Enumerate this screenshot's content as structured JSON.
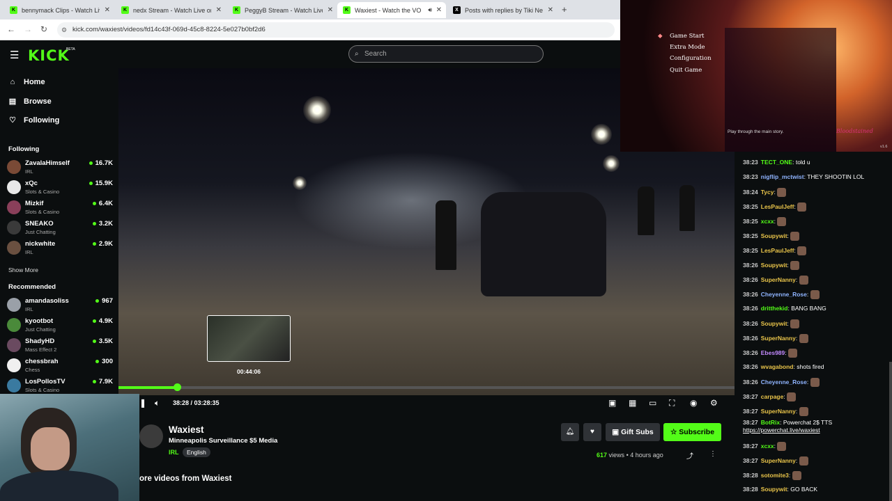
{
  "browser": {
    "tabs": [
      {
        "title": "bennymack Clips - Watch Live o",
        "icon": "kick-favicon"
      },
      {
        "title": "nedx Stream - Watch Live on Ki",
        "icon": "kick-favicon"
      },
      {
        "title": "PeggyB Stream - Watch Live on",
        "icon": "kick-favicon"
      },
      {
        "title": "Waxiest - Watch the VOD o",
        "icon": "kick-favicon",
        "active": true
      },
      {
        "title": "Posts with replies by Tiki NedX",
        "icon": "x-favicon"
      }
    ],
    "url": "kick.com/waxiest/videos/fd14c43f-069d-45c8-8224-5e027b0bf2d6"
  },
  "header": {
    "logo": "KICK",
    "beta": "BETA",
    "search_placeholder": "Search"
  },
  "sidebar": {
    "nav": [
      {
        "label": "Home",
        "icon": "home-icon"
      },
      {
        "label": "Browse",
        "icon": "browse-icon"
      },
      {
        "label": "Following",
        "icon": "heart-icon"
      }
    ],
    "following_title": "Following",
    "following": [
      {
        "name": "ZavalaHimself",
        "category": "IRL",
        "viewers": "16.7K"
      },
      {
        "name": "xQc",
        "category": "Slots & Casino",
        "viewers": "15.9K"
      },
      {
        "name": "Mizkif",
        "category": "Slots & Casino",
        "viewers": "6.4K"
      },
      {
        "name": "SNEAKO",
        "category": "Just Chatting",
        "viewers": "3.2K"
      },
      {
        "name": "nickwhite",
        "category": "IRL",
        "viewers": "2.9K"
      }
    ],
    "show_more": "Show More",
    "recommended_title": "Recommended",
    "recommended": [
      {
        "name": "amandasoliss",
        "category": "IRL",
        "viewers": "967"
      },
      {
        "name": "kyootbot",
        "category": "Just Chatting",
        "viewers": "4.9K"
      },
      {
        "name": "ShadyHD",
        "category": "Mass Effect 2",
        "viewers": "3.5K"
      },
      {
        "name": "chessbrah",
        "category": "Chess",
        "viewers": "300"
      },
      {
        "name": "LosPollosTV",
        "category": "Slots & Casino",
        "viewers": "7.9K"
      }
    ]
  },
  "player": {
    "hover_time": "00:44:06",
    "timecode": "38:28 / 03:28:35",
    "progress": 0.0945,
    "hover_position": 0.21,
    "controls": [
      "play-pause-icon",
      "volume-icon",
      "mini-player-icon",
      "clip-icon",
      "theater-icon",
      "fullscreen-icon",
      "speed-icon",
      "settings-icon"
    ]
  },
  "channel": {
    "name": "Waxiest",
    "stream_title": "Minneapolis Surveillance $5 Media",
    "category": "IRL",
    "language": "English",
    "gift_label": "Gift Subs",
    "subscribe_label": "Subscribe",
    "views": "617",
    "views_label": "views",
    "age": "4 hours ago",
    "more_videos": "ore videos from Waxiest"
  },
  "game_overlay": {
    "menu": [
      "Game Start",
      "Extra Mode",
      "Configuration",
      "Quit Game"
    ],
    "tip": "Play through the main story.",
    "logo": "Bloodstained",
    "version": "v1.6"
  },
  "chat": [
    {
      "time": "38:23",
      "user": "TECT_ONE",
      "color": "#53fc18",
      "text": "told u"
    },
    {
      "time": "38:23",
      "user": "nigflip_mctwist",
      "color": "#8fb4ff",
      "text": "THEY SHOOTIN LOL"
    },
    {
      "time": "38:24",
      "user": "Tycy",
      "color": "#e9c44a",
      "text": "",
      "emote": true
    },
    {
      "time": "38:25",
      "user": "LesPaulJeff",
      "color": "#e9c44a",
      "text": "",
      "emote": true
    },
    {
      "time": "38:25",
      "user": "xcxx",
      "color": "#53fc18",
      "text": "",
      "emote": true
    },
    {
      "time": "38:25",
      "user": "Soupywit",
      "color": "#e9c44a",
      "text": "",
      "emote": true
    },
    {
      "time": "38:25",
      "user": "LesPaulJeff",
      "color": "#e9c44a",
      "text": "",
      "emote": true
    },
    {
      "time": "38:26",
      "user": "Soupywit",
      "color": "#e9c44a",
      "text": "",
      "emote": true
    },
    {
      "time": "38:26",
      "user": "SuperNanny",
      "color": "#e9c44a",
      "text": "",
      "emote": true
    },
    {
      "time": "38:26",
      "user": "Cheyenne_Rose",
      "color": "#8fb4ff",
      "text": "",
      "emote": true
    },
    {
      "time": "38:26",
      "user": "dritthekid",
      "color": "#53fc18",
      "text": "BANG BANG"
    },
    {
      "time": "38:26",
      "user": "Soupywit",
      "color": "#e9c44a",
      "text": "",
      "emote": true
    },
    {
      "time": "38:26",
      "user": "SuperNanny",
      "color": "#e9c44a",
      "text": "",
      "emote": true
    },
    {
      "time": "38:26",
      "user": "Ebes989",
      "color": "#c38aff",
      "text": "",
      "emote": true
    },
    {
      "time": "38:26",
      "user": "wvagabond",
      "color": "#e9c44a",
      "text": "shots fired"
    },
    {
      "time": "38:26",
      "user": "Cheyenne_Rose",
      "color": "#8fb4ff",
      "text": "",
      "emote": true
    },
    {
      "time": "38:27",
      "user": "carpage",
      "color": "#e9c44a",
      "text": "",
      "emote": true
    },
    {
      "time": "38:27",
      "user": "SuperNanny",
      "color": "#e9c44a",
      "text": "",
      "emote": true
    },
    {
      "time": "38:27",
      "user": "BotRix",
      "color": "#53fc18",
      "text": "Powerchat 2$ TTS",
      "link": "https://powerchat.live/waxiest"
    },
    {
      "time": "38:27",
      "user": "xcxx",
      "color": "#53fc18",
      "text": "",
      "emote": true
    },
    {
      "time": "38:27",
      "user": "SuperNanny",
      "color": "#e9c44a",
      "text": "",
      "emote": true
    },
    {
      "time": "38:28",
      "user": "sotomite3",
      "color": "#e9c44a",
      "text": "",
      "emote": true
    },
    {
      "time": "38:28",
      "user": "Soupywit",
      "color": "#e9c44a",
      "text": "GO BACK"
    }
  ]
}
